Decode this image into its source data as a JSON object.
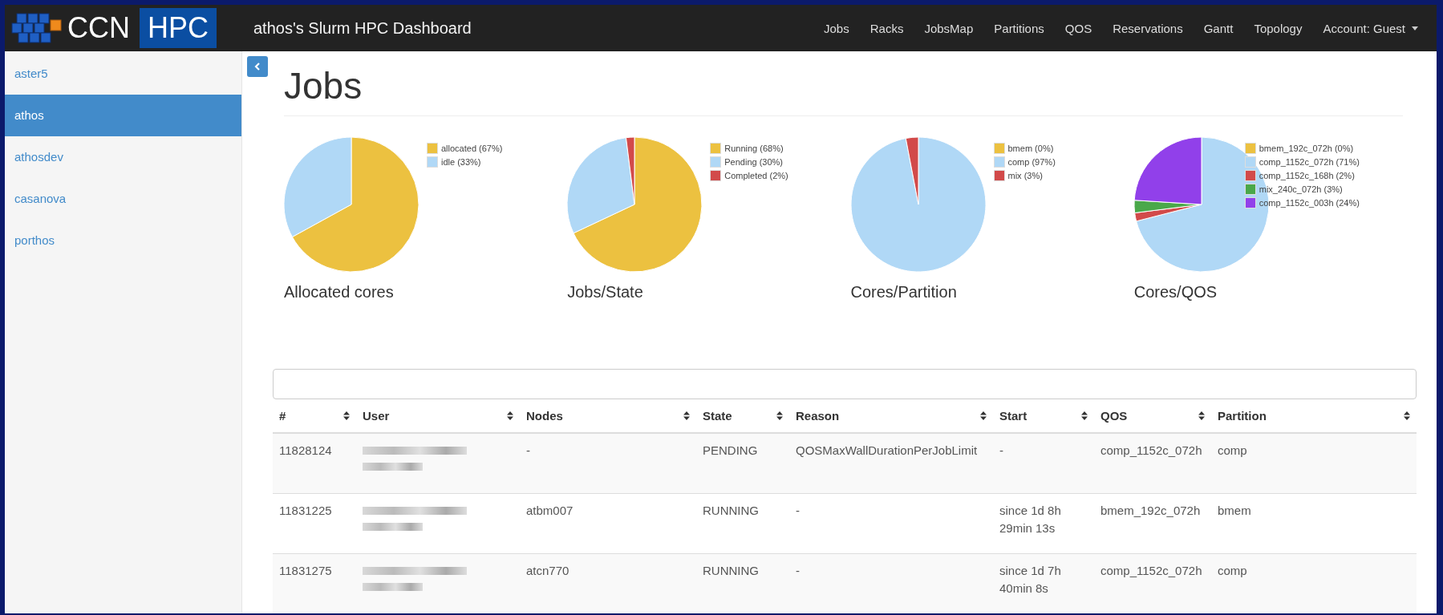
{
  "navbar": {
    "logo_left": "CCN",
    "logo_right": "HPC",
    "title": "athos's Slurm HPC Dashboard",
    "links": [
      {
        "label": "Jobs"
      },
      {
        "label": "Racks"
      },
      {
        "label": "JobsMap"
      },
      {
        "label": "Partitions"
      },
      {
        "label": "QOS"
      },
      {
        "label": "Reservations"
      },
      {
        "label": "Gantt"
      },
      {
        "label": "Topology"
      }
    ],
    "account": "Account: Guest"
  },
  "sidebar": {
    "items": [
      {
        "label": "aster5",
        "selected": false
      },
      {
        "label": "athos",
        "selected": true
      },
      {
        "label": "athosdev",
        "selected": false
      },
      {
        "label": "casanova",
        "selected": false
      },
      {
        "label": "porthos",
        "selected": false
      }
    ]
  },
  "page": {
    "heading": "Jobs"
  },
  "charts": [
    {
      "chart_data": {
        "type": "pie",
        "title": "Allocated cores",
        "categories": [
          "allocated (67%)",
          "idle (33%)"
        ],
        "values": [
          67,
          33
        ],
        "legend": "right",
        "colors": [
          "#ecc140",
          "#b0d8f6"
        ]
      }
    },
    {
      "chart_data": {
        "type": "pie",
        "title": "Jobs/State",
        "categories": [
          "Running (68%)",
          "Pending (30%)",
          "Completed (2%)"
        ],
        "values": [
          68,
          30,
          2
        ],
        "legend": "right",
        "colors": [
          "#ecc140",
          "#b0d8f6",
          "#d24a4a"
        ]
      }
    },
    {
      "chart_data": {
        "type": "pie",
        "title": "Cores/Partition",
        "categories": [
          "bmem (0%)",
          "comp (97%)",
          "mix (3%)"
        ],
        "values": [
          0,
          97,
          3
        ],
        "legend": "right",
        "colors": [
          "#ecc140",
          "#b0d8f6",
          "#d24a4a"
        ]
      }
    },
    {
      "chart_data": {
        "type": "pie",
        "title": "Cores/QOS",
        "categories": [
          "bmem_192c_072h (0%)",
          "comp_1152c_072h (71%)",
          "comp_1152c_168h (2%)",
          "mix_240c_072h (3%)",
          "comp_1152c_003h (24%)"
        ],
        "values": [
          0,
          71,
          2,
          3,
          24
        ],
        "legend": "right",
        "colors": [
          "#ecc140",
          "#b0d8f6",
          "#d24a4a",
          "#4aa84a",
          "#9140ea"
        ]
      }
    }
  ],
  "table": {
    "columns": [
      "#",
      "User",
      "Nodes",
      "State",
      "Reason",
      "Start",
      "QOS",
      "Partition"
    ],
    "rows": [
      {
        "id": "11828124",
        "nodes": "-",
        "state": "PENDING",
        "reason": "QOSMaxWallDurationPerJobLimit",
        "start": "-",
        "qos": "comp_1152c_072h",
        "partition": "comp"
      },
      {
        "id": "11831225",
        "nodes": "atbm007",
        "state": "RUNNING",
        "reason": "-",
        "start": "since 1d 8h 29min 13s",
        "qos": "bmem_192c_072h",
        "partition": "bmem"
      },
      {
        "id": "11831275",
        "nodes": "atcn770",
        "state": "RUNNING",
        "reason": "-",
        "start": "since 1d 7h 40min 8s",
        "qos": "comp_1152c_072h",
        "partition": "comp"
      }
    ]
  }
}
